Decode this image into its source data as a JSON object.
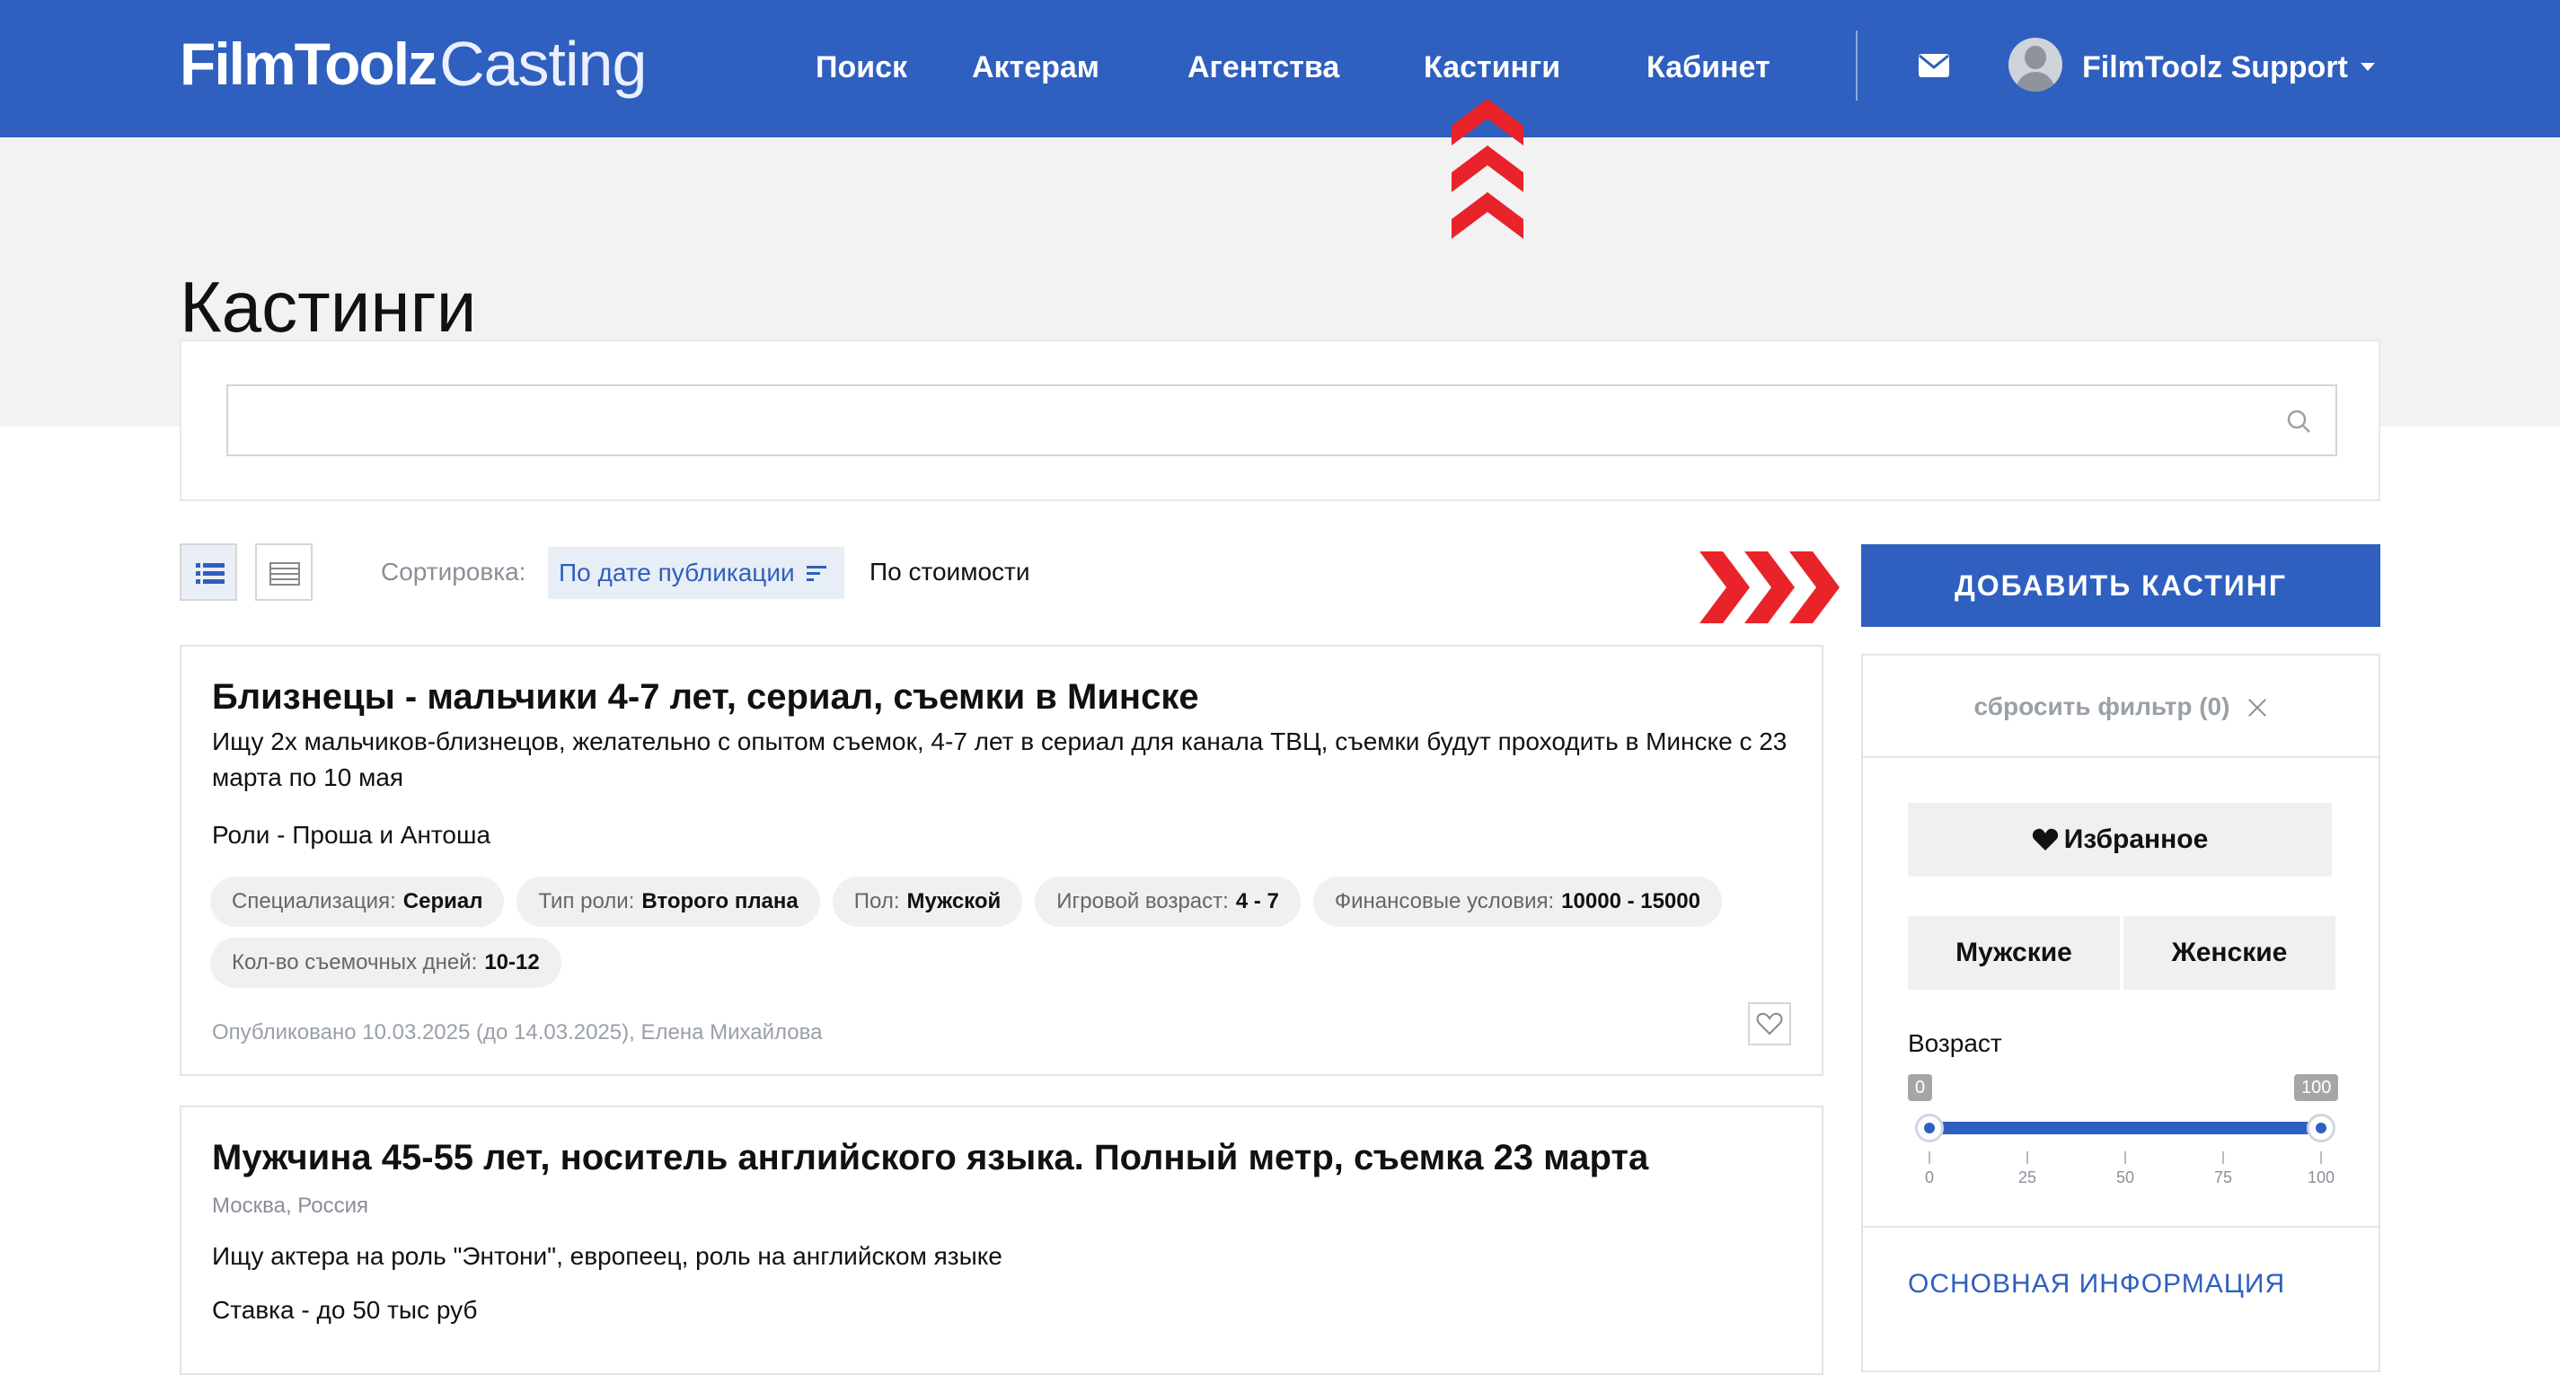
{
  "header": {
    "logo_bold": "FilmToolz",
    "logo_light": "Casting",
    "nav": [
      {
        "label": "Поиск"
      },
      {
        "label": "Актерам"
      },
      {
        "label": "Агентства"
      },
      {
        "label": "Кастинги"
      },
      {
        "label": "Кабинет"
      }
    ],
    "user_name": "FilmToolz Support",
    "icons": {
      "mail": "envelope-icon",
      "avatar": "user-avatar",
      "menu": "caret-down-icon"
    }
  },
  "page": {
    "title": "Кастинги"
  },
  "search": {
    "value": "",
    "placeholder": ""
  },
  "toolbar": {
    "sort_label": "Сортировка:",
    "sort_options": [
      {
        "label": "По дате публикации",
        "active": true
      },
      {
        "label": "По стоимости",
        "active": false
      }
    ],
    "add_button": "ДОБАВИТЬ КАСТИНГ"
  },
  "castings": [
    {
      "title": "Близнецы - мальчики 4-7 лет, сериал, съемки в Минске",
      "description": "Ищу 2х мальчиков-близнецов, желательно с опытом съемок, 4-7 лет в сериал для канала ТВЦ, съемки будут проходить в Минске с 23 марта по 10 мая",
      "roles": "Роли - Проша и Антоша",
      "tags": [
        {
          "key": "Специализация:",
          "value": "Сериал"
        },
        {
          "key": "Тип роли:",
          "value": "Второго плана"
        },
        {
          "key": "Пол:",
          "value": "Мужской"
        },
        {
          "key": "Игровой возраст:",
          "value": "4 - 7"
        },
        {
          "key": "Финансовые условия:",
          "value": "10000 - 15000"
        },
        {
          "key": "Кол-во съемочных дней:",
          "value": "10-12"
        }
      ],
      "meta": "Опубликовано 10.03.2025 (до 14.03.2025), Елена Михайлова"
    },
    {
      "title": "Мужчина 45-55 лет, носитель английского языка. Полный метр, съемка 23 марта",
      "location": "Москва, Россия",
      "description": "Ищу актера на роль \"Энтони\", европеец, роль на английском языке",
      "rate": "Ставка - до 50 тыс руб"
    }
  ],
  "sidebar": {
    "reset": "сбросить фильтр (0)",
    "favorites": "Избранное",
    "gender": [
      "Мужские",
      "Женские"
    ],
    "age_label": "Возраст",
    "age_min": 0,
    "age_max": 100,
    "age_min_label": "0",
    "age_max_label": "100",
    "age_ticks": [
      "0",
      "25",
      "50",
      "75",
      "100"
    ],
    "section": "ОСНОВНАЯ ИНФОРМАЦИЯ"
  },
  "colors": {
    "brand": "#2f5fbf",
    "accent_red": "#e8232a"
  }
}
